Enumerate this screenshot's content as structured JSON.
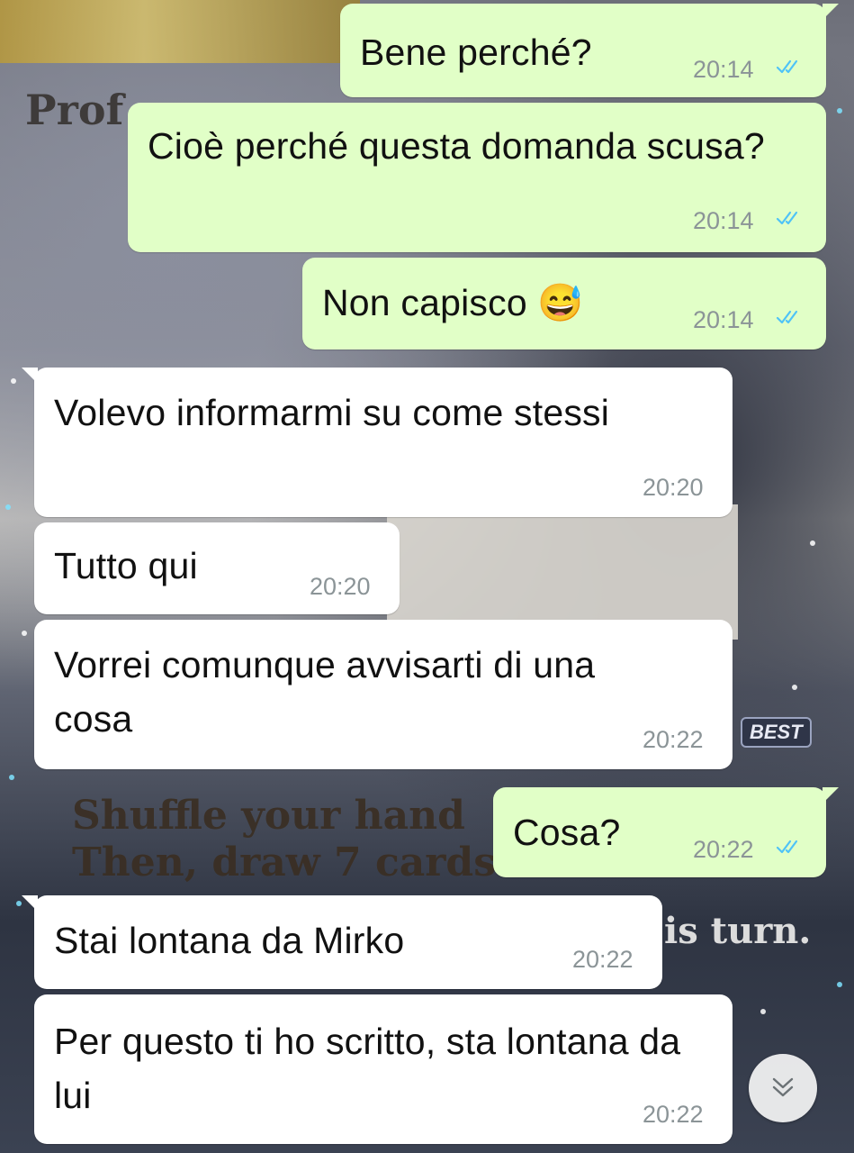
{
  "wallpaper": {
    "card_text_prof": "Prof",
    "card_badge": "BEST",
    "card_text_lines": [
      "Shuffle your hand",
      "Then, draw 7 cards"
    ],
    "card_text_right": "is turn."
  },
  "messages": [
    {
      "direction": "outgoing",
      "text": "Bene perché?",
      "time": "20:14",
      "status": "read"
    },
    {
      "direction": "outgoing",
      "text": "Cioè perché questa domanda scusa?",
      "time": "20:14",
      "status": "read"
    },
    {
      "direction": "outgoing",
      "text": "Non capisco 😅",
      "time": "20:14",
      "status": "read"
    },
    {
      "direction": "incoming",
      "text": "Volevo informarmi su come stessi",
      "time": "20:20"
    },
    {
      "direction": "incoming",
      "text": "Tutto qui",
      "time": "20:20"
    },
    {
      "direction": "incoming",
      "text": "Vorrei comunque avvisarti di una cosa",
      "time": "20:22"
    },
    {
      "direction": "outgoing",
      "text": "Cosa?",
      "time": "20:22",
      "status": "read"
    },
    {
      "direction": "incoming",
      "text": "Stai lontana da Mirko",
      "time": "20:22"
    },
    {
      "direction": "incoming",
      "text": "Per questo ti ho scritto, sta lontana da lui",
      "time": "20:22"
    }
  ],
  "icons": {
    "read_receipt": "double-check-icon",
    "scroll_down": "chevron-double-down-icon"
  },
  "colors": {
    "outgoing_bubble": "#e1ffc7",
    "incoming_bubble": "#ffffff",
    "read_ticks": "#4fc3f7",
    "timestamp": "#8b9497"
  }
}
